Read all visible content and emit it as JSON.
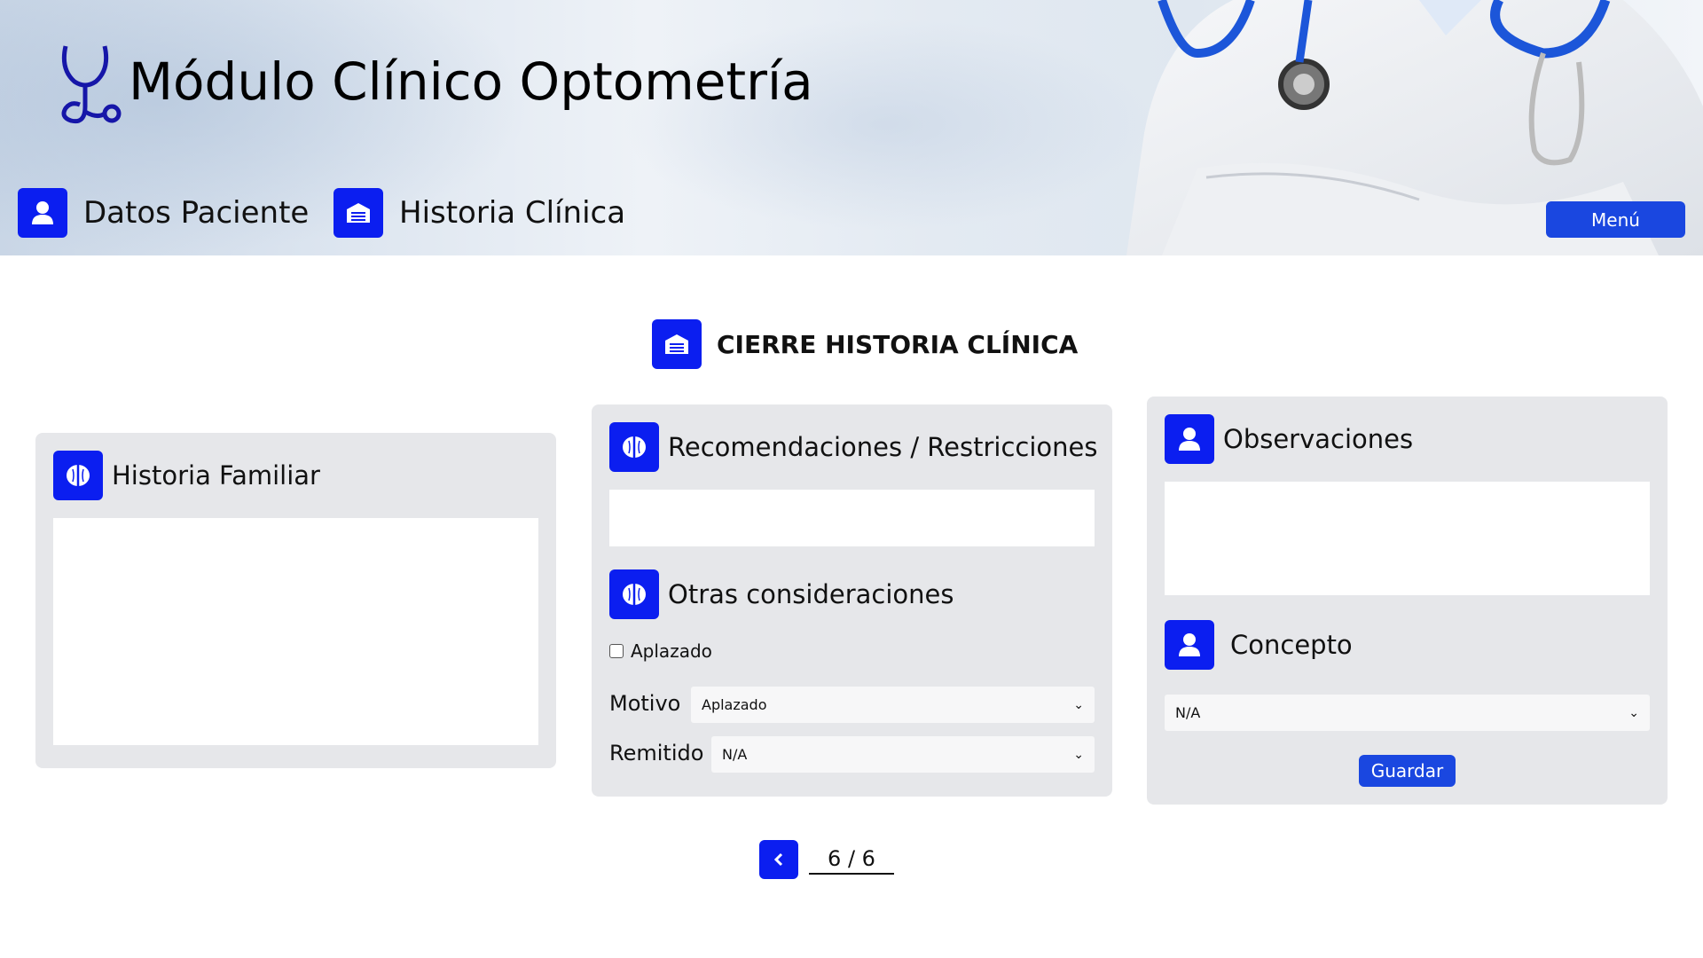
{
  "app": {
    "title": "Módulo Clínico Optometría"
  },
  "nav": {
    "datos_paciente": "Datos Paciente",
    "historia_clinica": "Historia Clínica",
    "menu": "Menú"
  },
  "section": {
    "title": "CIERRE HISTORIA CLÍNICA"
  },
  "cards": {
    "historia_familiar": {
      "title": "Historia Familiar",
      "value": ""
    },
    "recomendaciones": {
      "title": "Recomendaciones / Restricciones",
      "value": ""
    },
    "otras": {
      "title": "Otras consideraciones",
      "aplazado_label": "Aplazado",
      "aplazado_checked": false,
      "motivo_label": "Motivo",
      "motivo_value": "Aplazado",
      "remitido_label": "Remitido",
      "remitido_value": "N/A"
    },
    "observaciones": {
      "title": "Observaciones",
      "value": ""
    },
    "concepto": {
      "title": "Concepto",
      "value": "N/A",
      "save": "Guardar"
    }
  },
  "pagination": {
    "indicator": "6 / 6"
  },
  "icons": {
    "user": "user-icon",
    "clinic": "clinic-icon",
    "brain": "brain-icon",
    "chevron_left": "chevron-left-icon",
    "chevron_down": "chevron-down-icon",
    "logo": "stethoscope-icon"
  },
  "colors": {
    "accent": "#0b1ef0",
    "button": "#1a47e0",
    "card": "#e6e7ea"
  }
}
